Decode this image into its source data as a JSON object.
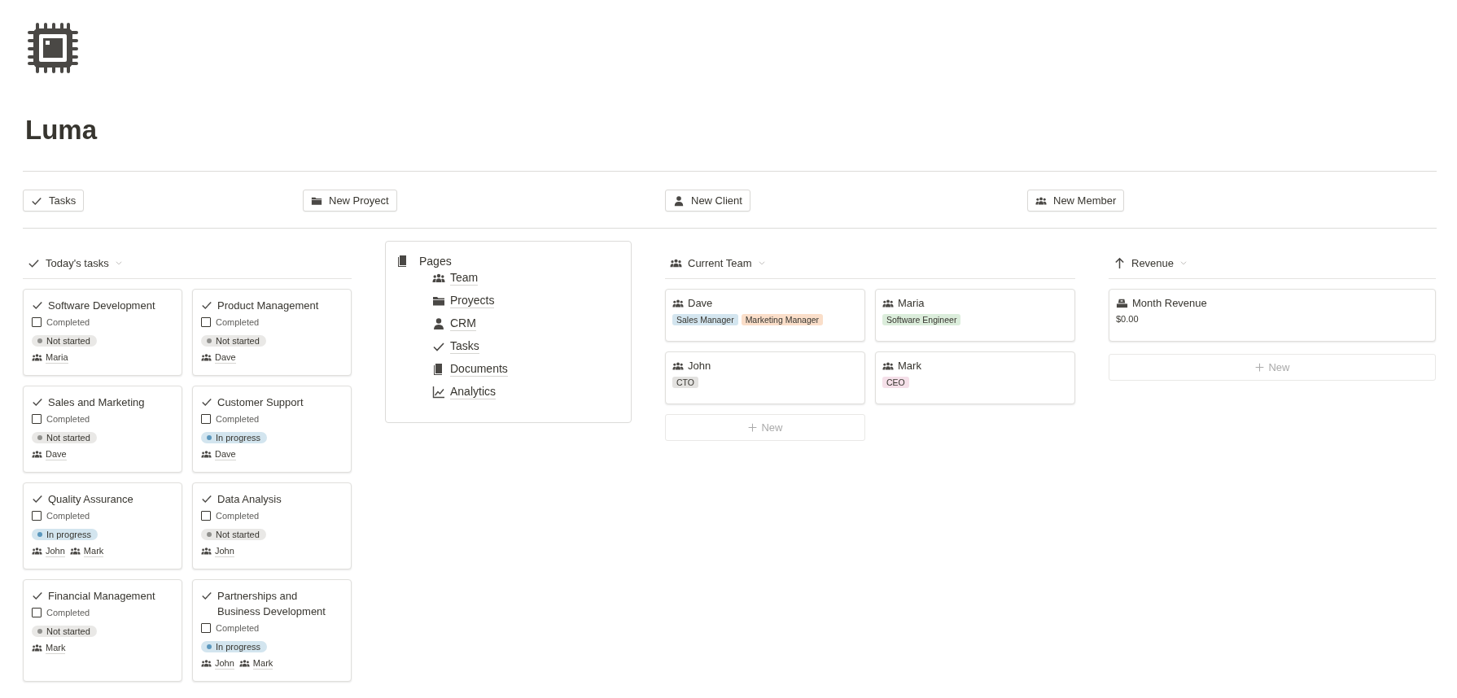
{
  "page": {
    "title": "Luma"
  },
  "quick_buttons": [
    {
      "label": "Tasks",
      "kind": "check"
    },
    {
      "label": "New Proyect",
      "kind": "folder"
    },
    {
      "label": "New Client",
      "kind": "person"
    },
    {
      "label": "New Member",
      "kind": "people"
    }
  ],
  "tasks": {
    "title": "Today's tasks",
    "cards": [
      {
        "title": "Software Development",
        "checkbox_label": "Completed",
        "completed": false,
        "status": {
          "label": "Not started",
          "kind": "not_started"
        },
        "people": [
          "Maria"
        ]
      },
      {
        "title": "Product Management",
        "checkbox_label": "Completed",
        "completed": false,
        "status": {
          "label": "Not started",
          "kind": "not_started"
        },
        "people": [
          "Dave"
        ]
      },
      {
        "title": "Sales and Marketing",
        "checkbox_label": "Completed",
        "completed": false,
        "status": {
          "label": "Not started",
          "kind": "not_started"
        },
        "people": [
          "Dave"
        ]
      },
      {
        "title": "Customer Support",
        "checkbox_label": "Completed",
        "completed": false,
        "status": {
          "label": "In progress",
          "kind": "in_progress"
        },
        "people": [
          "Dave"
        ]
      },
      {
        "title": "Quality Assurance",
        "checkbox_label": "Completed",
        "completed": false,
        "status": {
          "label": "In progress",
          "kind": "in_progress"
        },
        "people": [
          "John",
          "Mark"
        ]
      },
      {
        "title": "Data Analysis",
        "checkbox_label": "Completed",
        "completed": false,
        "status": {
          "label": "Not started",
          "kind": "not_started"
        },
        "people": [
          "John"
        ]
      },
      {
        "title": "Financial Management",
        "checkbox_label": "Completed",
        "completed": false,
        "status": {
          "label": "Not started",
          "kind": "not_started"
        },
        "people": [
          "Mark"
        ]
      },
      {
        "title": "Partnerships and Business Development",
        "checkbox_label": "Completed",
        "completed": false,
        "status": {
          "label": "In progress",
          "kind": "in_progress"
        },
        "people": [
          "John",
          "Mark"
        ]
      }
    ]
  },
  "pages": {
    "title": "Pages",
    "items": [
      {
        "label": "Team",
        "kind": "people"
      },
      {
        "label": "Proyects",
        "kind": "folder"
      },
      {
        "label": "CRM",
        "kind": "person"
      },
      {
        "label": "Tasks",
        "kind": "check"
      },
      {
        "label": "Documents",
        "kind": "pages"
      },
      {
        "label": "Analytics",
        "kind": "chart"
      }
    ]
  },
  "team": {
    "title": "Current Team",
    "new_label": "New",
    "members": [
      {
        "name": "Dave",
        "roles": [
          {
            "label": "Sales Manager",
            "color": "#d3e5ef"
          },
          {
            "label": "Marketing Manager",
            "color": "#fadec9"
          }
        ]
      },
      {
        "name": "Maria",
        "roles": [
          {
            "label": "Software Engineer",
            "color": "#dbeddb"
          }
        ]
      },
      {
        "name": "John",
        "roles": [
          {
            "label": "CTO",
            "color": "#e3e2e0"
          }
        ]
      },
      {
        "name": "Mark",
        "roles": [
          {
            "label": "CEO",
            "color": "#f5e0e9"
          }
        ]
      }
    ]
  },
  "revenue": {
    "title": "Revenue",
    "new_label": "New",
    "items": [
      {
        "title": "Month Revenue",
        "amount": "$0.00"
      }
    ]
  }
}
